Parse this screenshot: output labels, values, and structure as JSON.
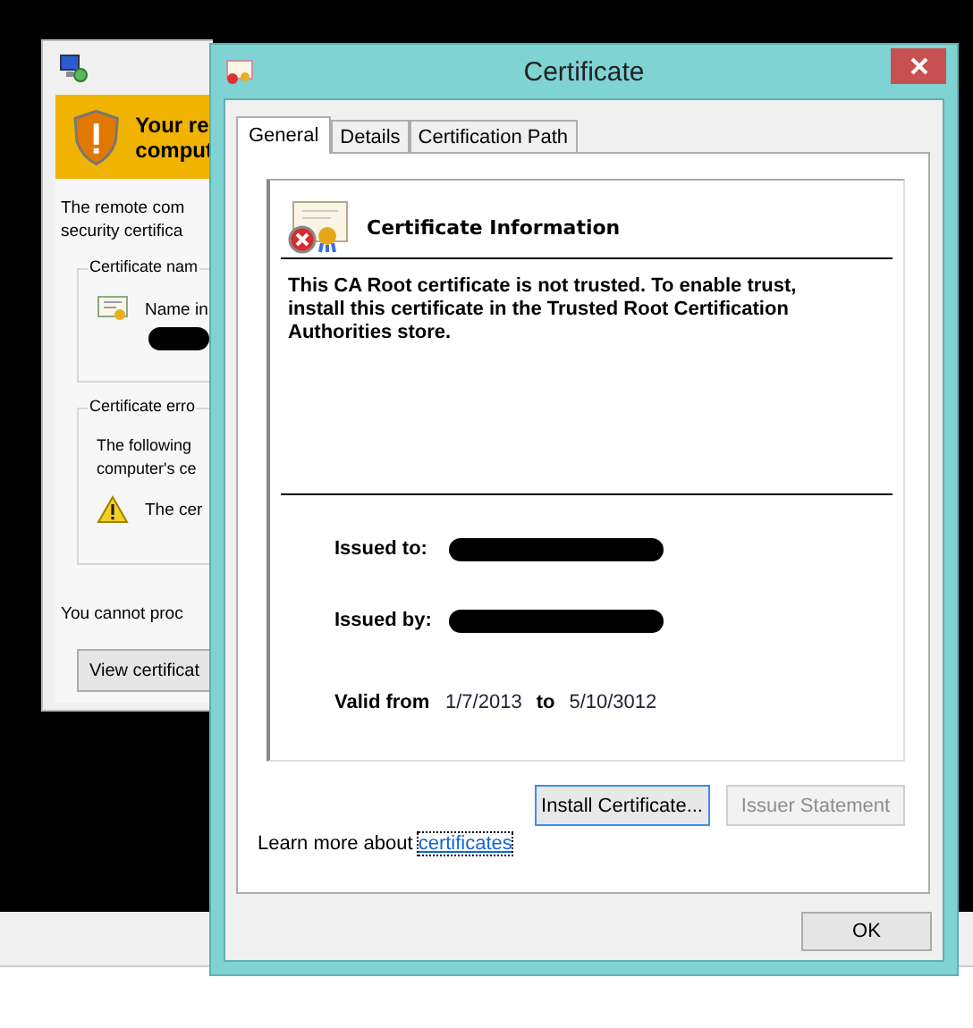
{
  "background_window": {
    "banner_lines": [
      "Your re",
      "comput"
    ],
    "intro_lines": [
      "The remote com",
      "security certifica"
    ],
    "name_group": {
      "title": "Certificate nam",
      "label": "Name in"
    },
    "error_group": {
      "title": "Certificate erro",
      "lines": [
        "The following",
        "computer's ce"
      ],
      "item": "The cer"
    },
    "footer": "You cannot proc",
    "button": "View certificat"
  },
  "window": {
    "title": "Certificate"
  },
  "tabs": [
    {
      "label": "General",
      "selected": true
    },
    {
      "label": "Details",
      "selected": false
    },
    {
      "label": "Certification Path",
      "selected": false
    }
  ],
  "info": {
    "heading": "Certificate Information",
    "message": "This CA Root certificate is not trusted. To enable trust, install this certificate in the Trusted Root Certification Authorities store.",
    "issued_to_label": "Issued to:",
    "issued_by_label": "Issued by:",
    "valid_from_label": "Valid from",
    "valid_from": "1/7/2013",
    "to_label": "to",
    "valid_to": "5/10/3012"
  },
  "buttons": [
    {
      "label": "Install Certificate...",
      "disabled": false,
      "focused": true
    },
    {
      "label": "Issuer Statement",
      "disabled": true,
      "focused": false
    }
  ],
  "learn_more": {
    "text": "Learn more about",
    "link": "certificates"
  },
  "ok_button": "OK"
}
